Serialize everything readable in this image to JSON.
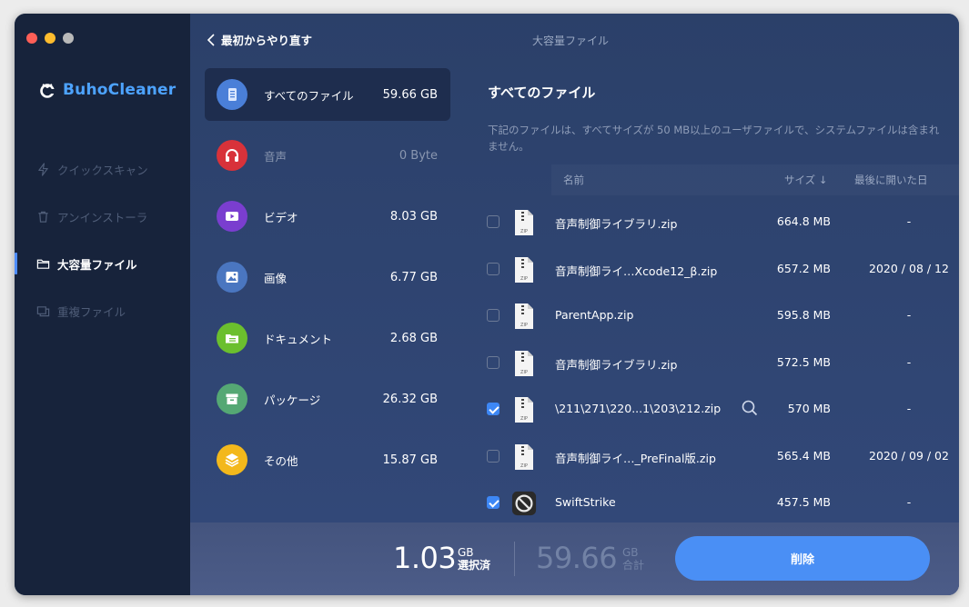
{
  "app": {
    "brand": "BuhoCleaner",
    "window_title": "大容量ファイル"
  },
  "sidebar": {
    "items": [
      {
        "label": "クイックスキャン",
        "icon": "bolt-icon",
        "active": false
      },
      {
        "label": "アンインストーラ",
        "icon": "trash-icon",
        "active": false
      },
      {
        "label": "大容量ファイル",
        "icon": "folder-icon",
        "active": true
      },
      {
        "label": "重複ファイル",
        "icon": "duplicate-icon",
        "active": false
      }
    ]
  },
  "header": {
    "back_label": "最初からやり直す"
  },
  "categories": [
    {
      "label": "すべてのファイル",
      "size": "59.66 GB",
      "icon": "all-files-icon",
      "color": "#4a7fd8"
    },
    {
      "label": "音声",
      "size": "0 Byte",
      "icon": "headphones-icon",
      "color": "#d8323a"
    },
    {
      "label": "ビデオ",
      "size": "8.03 GB",
      "icon": "video-icon",
      "color": "#7a3ecf"
    },
    {
      "label": "画像",
      "size": "6.77 GB",
      "icon": "image-icon",
      "color": "#4a76c0"
    },
    {
      "label": "ドキュメント",
      "size": "2.68 GB",
      "icon": "document-icon",
      "color": "#6bbf2e"
    },
    {
      "label": "パッケージ",
      "size": "26.32 GB",
      "icon": "package-icon",
      "color": "#55a874"
    },
    {
      "label": "その他",
      "size": "15.87 GB",
      "icon": "other-icon",
      "color": "#f3b81c"
    }
  ],
  "panel": {
    "title": "すべてのファイル",
    "description": "下記のファイルは、すべてサイズが 50 MB以上のユーザファイルで、システムファイルは含まれません。",
    "columns": {
      "name": "名前",
      "size": "サイズ ↓",
      "last_opened": "最後に開いた日"
    }
  },
  "files": [
    {
      "name": "音声制御ライブラリ.zip",
      "size": "664.8 MB",
      "date": "-",
      "checked": false,
      "icon": "zip-icon"
    },
    {
      "name": "音声制御ライ…Xcode12_β.zip",
      "size": "657.2 MB",
      "date": "2020 / 08 / 12",
      "checked": false,
      "icon": "zip-icon"
    },
    {
      "name": "ParentApp.zip",
      "size": "595.8 MB",
      "date": "-",
      "checked": false,
      "icon": "zip-icon"
    },
    {
      "name": "音声制御ライブラリ.zip",
      "size": "572.5 MB",
      "date": "-",
      "checked": false,
      "icon": "zip-icon"
    },
    {
      "name": "\\211\\271\\220...1\\203\\212.zip",
      "size": "570 MB",
      "date": "-",
      "checked": true,
      "icon": "zip-icon"
    },
    {
      "name": "音声制御ライ…_PreFinal版.zip",
      "size": "565.4 MB",
      "date": "2020 / 09 / 02",
      "checked": false,
      "icon": "zip-icon"
    },
    {
      "name": "SwiftStrike",
      "size": "457.5 MB",
      "date": "-",
      "checked": true,
      "icon": "app-icon"
    }
  ],
  "footer": {
    "selected_value": "1.03",
    "selected_unit": "GB",
    "selected_label": "選択済",
    "total_value": "59.66",
    "total_unit": "GB",
    "total_label": "合計",
    "delete_label": "削除"
  }
}
